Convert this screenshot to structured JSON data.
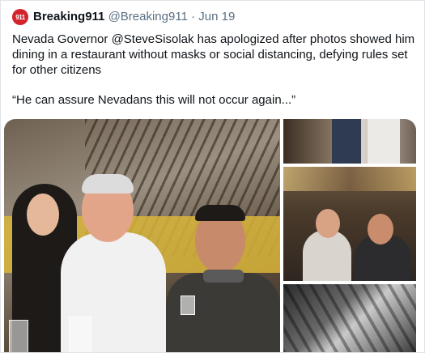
{
  "tweet": {
    "avatar_text": "911",
    "author_name": "Breaking911",
    "author_handle": "@Breaking911",
    "separator": "·",
    "date": "Jun 19",
    "text_line1": "Nevada Governor @SteveSisolak has apologized after photos showed him dining in a restaurant without masks or social distancing, defying rules set for other citizens",
    "text_line2": "“He can assure Nevadans this will not occur again...”"
  }
}
